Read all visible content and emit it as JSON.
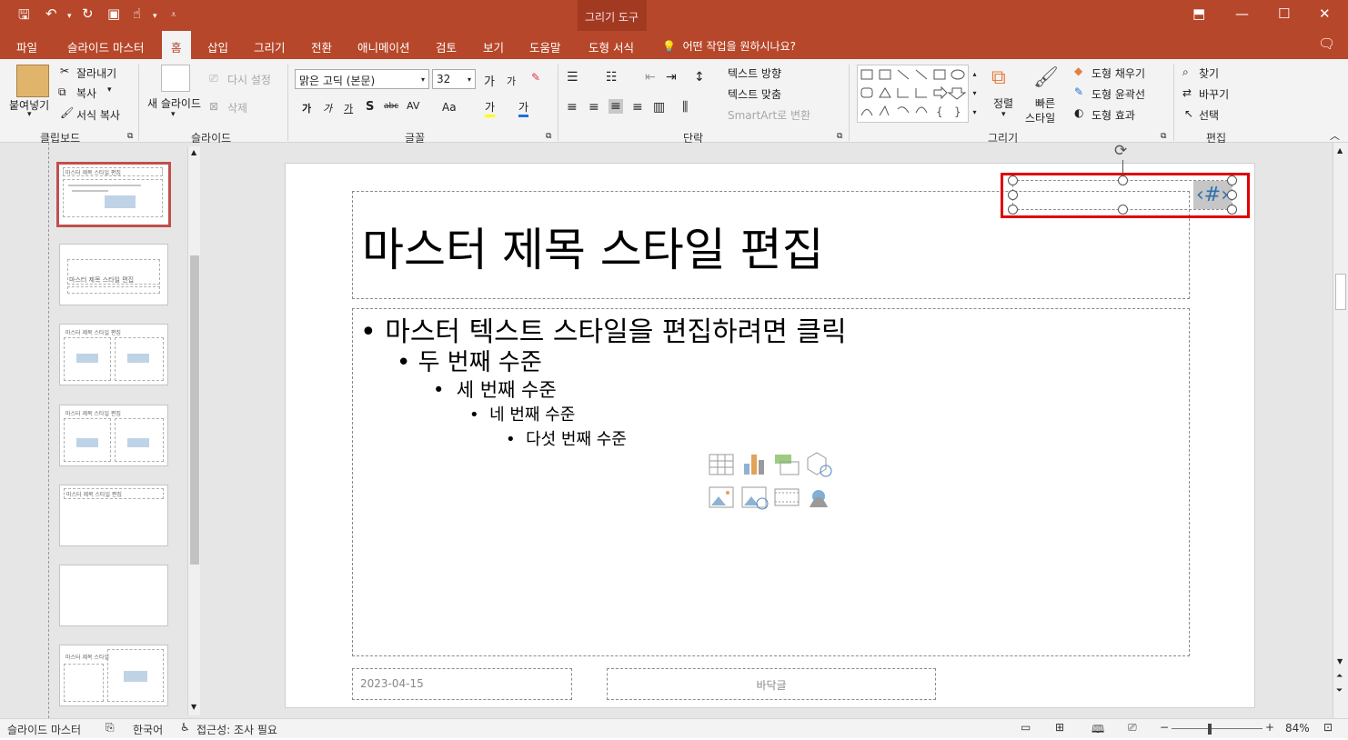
{
  "titlebar": {
    "context_title": "그리기 도구"
  },
  "tabs": [
    "파일",
    "슬라이드 마스터",
    "홈",
    "삽입",
    "그리기",
    "전환",
    "애니메이션",
    "검토",
    "보기",
    "도움말",
    "도형 서식"
  ],
  "tell_me": "어떤 작업을 원하시나요?",
  "ribbon": {
    "clipboard": {
      "paste": "붙여넣기",
      "cut": "잘라내기",
      "copy": "복사",
      "format_painter": "서식 복사",
      "group": "클립보드"
    },
    "slides": {
      "new_slide": "새 슬라이드",
      "reset": "다시 설정",
      "delete": "삭제",
      "group": "슬라이드"
    },
    "font": {
      "name": "맑은 고딕 (본문)",
      "size": "32",
      "group": "글꼴",
      "increase": "가",
      "decrease": "가",
      "bold": "가",
      "italic": "가",
      "underline": "가",
      "strike": "가",
      "spacing": "AV",
      "case": "Aa",
      "highlight": "가",
      "color": "가"
    },
    "paragraph": {
      "text_direction": "텍스트 방향",
      "align_text": "텍스트 맞춤",
      "smartart": "SmartArt로 변환",
      "group": "단락"
    },
    "drawing": {
      "arrange": "정렬",
      "quick_styles_1": "빠른",
      "quick_styles_2": "스타일",
      "fill": "도형 채우기",
      "outline": "도형 윤곽선",
      "effects": "도형 효과",
      "group": "그리기"
    },
    "editing": {
      "find": "찾기",
      "replace": "바꾸기",
      "select": "선택",
      "group": "편집"
    }
  },
  "slide": {
    "title": "마스터 제목 스타일 편집",
    "bullets": [
      "마스터 텍스트 스타일을 편집하려면 클릭",
      "두 번째 수준",
      "세 번째 수준",
      "네 번째 수준",
      "다섯 번째 수준"
    ],
    "date": "2023-04-15",
    "footer": "바닥글",
    "slide_number": "‹#›"
  },
  "thumbnails": [
    {
      "title": "마스터 제목 스타일 편집"
    },
    {
      "title": "마스터 제목 스타일 편집"
    },
    {
      "title": "마스터 제목 스타일 편집"
    },
    {
      "title": "마스터 제목 스타일 편집"
    },
    {
      "title": "마스터 제목 스타일 편집"
    },
    {
      "title": ""
    },
    {
      "title": "마스터 제목 스타일"
    }
  ],
  "status": {
    "mode": "슬라이드 마스터",
    "language": "한국어",
    "accessibility": "접근성: 조사 필요",
    "zoom": "84%",
    "zoom_level": 0.84
  },
  "colors": {
    "accent": "#b7472a",
    "selection": "#e00000"
  }
}
